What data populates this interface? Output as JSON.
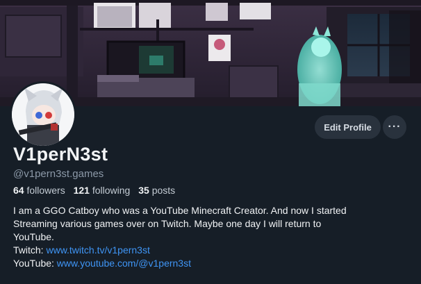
{
  "profile": {
    "display_name": "V1perN3st",
    "handle": "@v1pern3st.games",
    "followers_count": "64",
    "followers_label": "followers",
    "following_count": "121",
    "following_label": "following",
    "posts_count": "35",
    "posts_label": "posts",
    "bio": {
      "line1": "I am a GGO Catboy who was a YouTube Minecraft Creator. And now I started",
      "line2": "Streaming various games over on Twitch. Maybe one day I will return to",
      "line3": "YouTube.",
      "twitch_label": "Twitch: ",
      "twitch_url": "www.twitch.tv/v1pern3st",
      "youtube_label": "YouTube: ",
      "youtube_url": "www.youtube.com/@v1pern3st"
    }
  },
  "actions": {
    "edit_profile_label": "Edit Profile",
    "more_label": "···"
  },
  "colors": {
    "background": "#161e27",
    "button_bg": "#29323d",
    "link": "#3f95f5",
    "muted_text": "#8c99a8"
  },
  "icons": {
    "more": "more-horizontal-icon"
  }
}
